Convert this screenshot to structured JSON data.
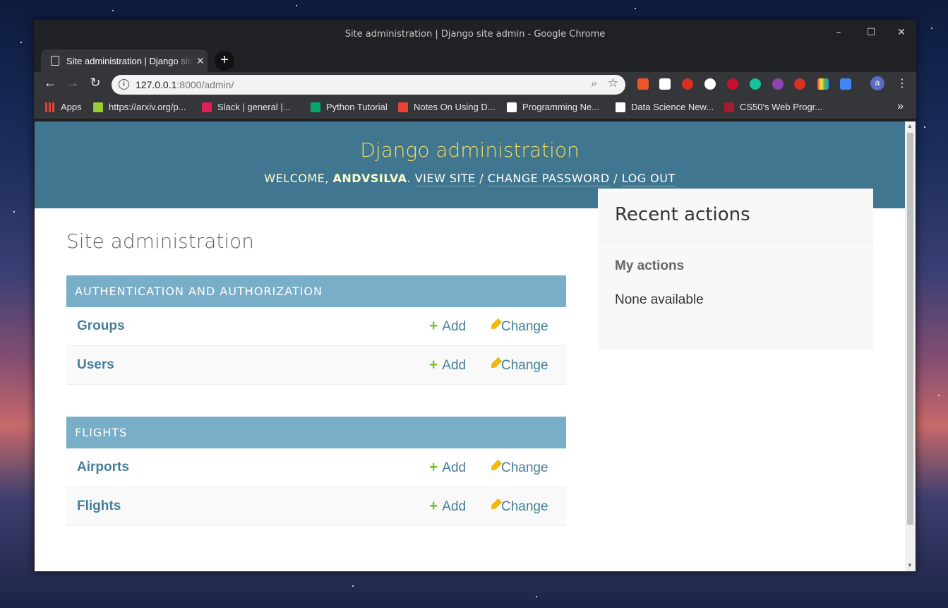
{
  "window": {
    "title": "Site administration | Django site admin - Google Chrome",
    "controls": [
      "–",
      "☐",
      "✕"
    ]
  },
  "tab": {
    "title": "Site administration | Django site admin",
    "close": "✕"
  },
  "toolbar": {
    "url_host": "127.0.0.1",
    "url_rest": ":8000/admin/",
    "avatar_letter": "a"
  },
  "bookmarks": [
    {
      "label": "Apps",
      "color": "#e94235"
    },
    {
      "label": "https://arxiv.org/p...",
      "color": "#9acd32"
    },
    {
      "label": "Slack | general |...",
      "color": "#e01e5a"
    },
    {
      "label": "Python Tutorial",
      "color": "#04aa6d"
    },
    {
      "label": "Notes On Using D...",
      "color": "#ea4335"
    },
    {
      "label": "Programming Ne...",
      "color": "#000000"
    },
    {
      "label": "Data Science New...",
      "color": "#000000"
    },
    {
      "label": "CS50's Web Progr...",
      "color": "#a51c30"
    }
  ],
  "admin": {
    "branding": "Django administration",
    "welcome": "WELCOME, ",
    "username": "ANDVSILVA",
    "view_site": "VIEW SITE",
    "change_password": "CHANGE PASSWORD",
    "log_out": "LOG OUT",
    "page_title": "Site administration",
    "modules": [
      {
        "caption": "AUTHENTICATION AND AUTHORIZATION",
        "models": [
          {
            "name": "Groups"
          },
          {
            "name": "Users"
          }
        ]
      },
      {
        "caption": "FLIGHTS",
        "models": [
          {
            "name": "Airports"
          },
          {
            "name": "Flights"
          }
        ]
      }
    ],
    "add_label": "Add",
    "change_label": "Change",
    "recent_actions": "Recent actions",
    "my_actions": "My actions",
    "none_available": "None available"
  },
  "colors": {
    "header_bg": "#417690",
    "branding": "#f5dd5d",
    "caption_bg": "#79aec8",
    "link": "#447e9b",
    "add_icon": "#70bf2b",
    "change_icon": "#efb80b"
  }
}
